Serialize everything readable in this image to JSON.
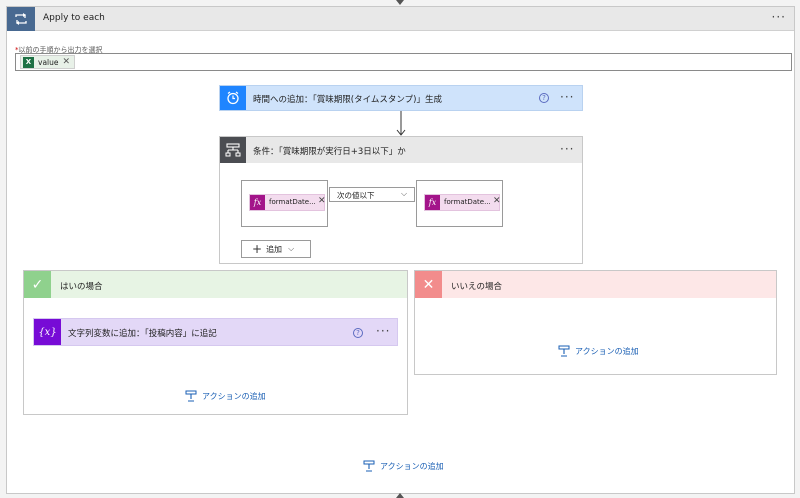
{
  "apply": {
    "title": "Apply to each",
    "more_label": "···",
    "prev_output_label": "以前の手順から出力を選択",
    "required_mark": "*",
    "value_token": "value"
  },
  "time_action": {
    "title": "時間への追加：「賞味期限(タイムスタンプ)」生成",
    "more_label": "···"
  },
  "condition": {
    "title": "条件：「賞味期限が実行日+3日以下」か",
    "more_label": "···",
    "left_operand": "formatDate...",
    "right_operand": "formatDate...",
    "operator": "次の値以下",
    "add_label": "追加"
  },
  "yes_branch": {
    "title": "はいの場合",
    "action_title": "文字列変数に追加：「投稿内容」に追記",
    "more_label": "···",
    "add_action_label": "アクションの追加"
  },
  "no_branch": {
    "title": "いいえの場合",
    "add_action_label": "アクションの追加"
  },
  "bottom": {
    "add_action_label": "アクションの追加"
  },
  "colors": {
    "loop_icon": "#486991",
    "time_icon": "#1f85ff",
    "condition_icon": "#4b4d52",
    "yes_icon": "#8fd18d",
    "no_icon": "#f28c8c",
    "variable_icon": "#770bd6",
    "expression_icon": "#a3148a",
    "excel_icon": "#1e7145",
    "link": "#1a5fb4"
  }
}
